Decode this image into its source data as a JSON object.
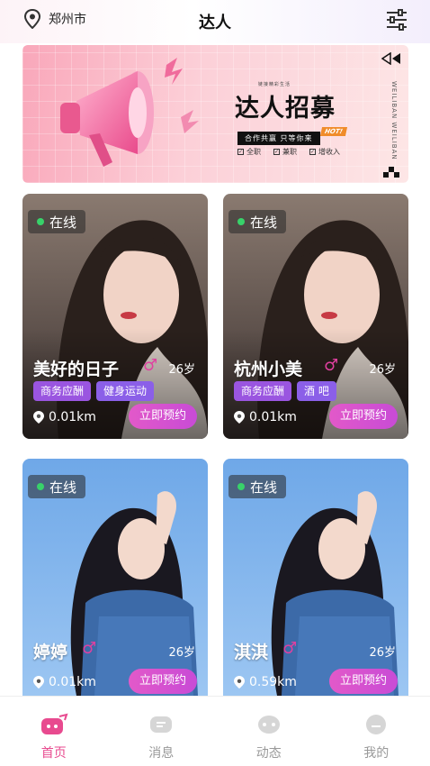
{
  "header": {
    "location": "郑州市",
    "title": "达人",
    "location_icon": "location-pin-icon",
    "filter_icon": "filter-sliders-icon"
  },
  "banner": {
    "title": "达人招募",
    "small_text": "链接精彩生活",
    "subtitle": "合作共赢  只等你来",
    "hot": "HOT!",
    "options": [
      "全职",
      "兼职",
      "增收入"
    ],
    "side_text": "WEILIBAN WEILIBAN"
  },
  "cards": [
    {
      "online": "在线",
      "name": "美好的日子",
      "gender": "♂",
      "age": "26岁",
      "tags": [
        "商务应酬",
        "健身运动"
      ],
      "distance": "0.01km",
      "button": "立即预约"
    },
    {
      "online": "在线",
      "name": "杭州小美",
      "gender": "♂",
      "age": "26岁",
      "tags": [
        "商务应酬",
        "酒 吧"
      ],
      "distance": "0.01km",
      "button": "立即预约"
    },
    {
      "online": "在线",
      "name": "婷婷",
      "gender": "♂",
      "age": "26岁",
      "tags": [],
      "distance": "0.01km",
      "button": "立即预约"
    },
    {
      "online": "在线",
      "name": "淇淇",
      "gender": "♂",
      "age": "26岁",
      "tags": [],
      "distance": "0.59km",
      "button": "立即预约"
    }
  ],
  "tabbar": {
    "items": [
      {
        "label": "首页",
        "icon": "home-icon",
        "active": true
      },
      {
        "label": "消息",
        "icon": "message-icon",
        "active": false
      },
      {
        "label": "动态",
        "icon": "moments-icon",
        "active": false
      },
      {
        "label": "我的",
        "icon": "profile-icon",
        "active": false
      }
    ]
  },
  "colors": {
    "accent": "#e84a8f",
    "button": "#d552cf",
    "tag": "#9a55e0",
    "online": "#38d26a"
  }
}
